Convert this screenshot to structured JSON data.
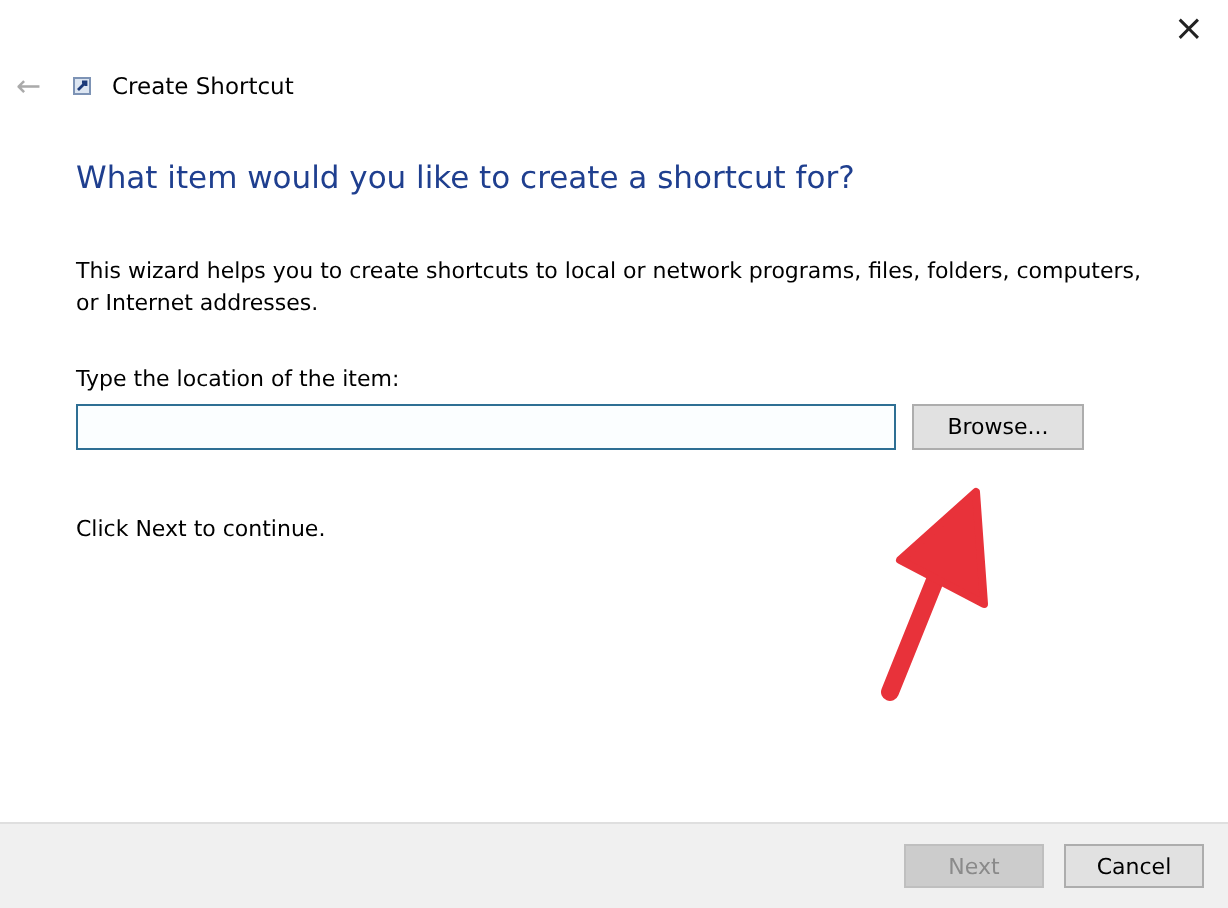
{
  "window": {
    "title": "Create Shortcut",
    "close": "×",
    "back": "←"
  },
  "heading": "What item would you like to create a shortcut for?",
  "description": "This wizard helps you to create shortcuts to local or network programs, files, folders, computers, or Internet addresses.",
  "location": {
    "label": "Type the location of the item:",
    "focused": true
  },
  "browse_button": "Browse...",
  "hint": "Click Next to continue.",
  "buttons": [
    {
      "label": "Next",
      "disabled": true
    },
    {
      "label": "Cancel",
      "disabled": false
    }
  ]
}
